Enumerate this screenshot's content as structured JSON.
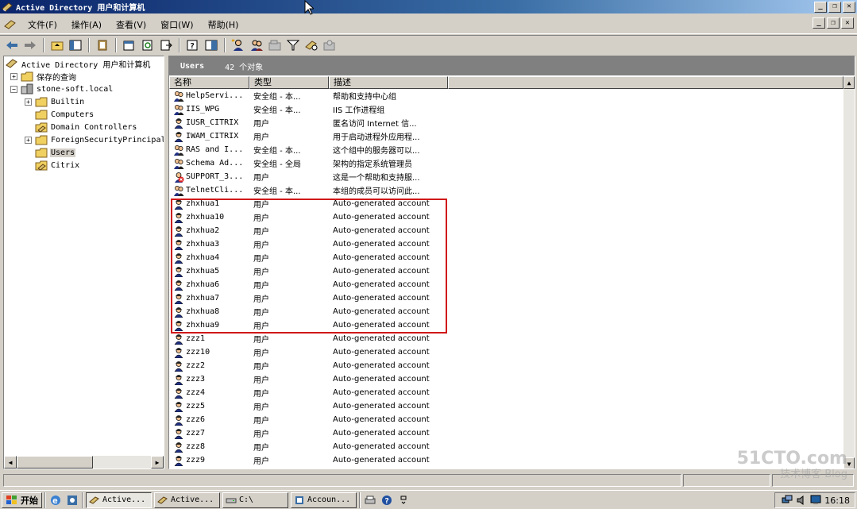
{
  "window": {
    "title": "Active Directory 用户和计算机"
  },
  "menu": {
    "items": [
      "文件(F)",
      "操作(A)",
      "查看(V)",
      "窗口(W)",
      "帮助(H)"
    ]
  },
  "tree": {
    "root": "Active Directory 用户和计算机",
    "saved_queries": "保存的查询",
    "domain": "stone-soft.local",
    "children": [
      "Builtin",
      "Computers",
      "Domain Controllers",
      "ForeignSecurityPrincipals",
      "Users",
      "Citrix"
    ],
    "selected": "Users"
  },
  "list": {
    "header_title": "Users",
    "object_count": "42 个对象",
    "columns": [
      "名称",
      "类型",
      "描述"
    ],
    "rows": [
      {
        "name": "HelpServi...",
        "type": "安全组 - 本...",
        "desc": "帮助和支持中心组",
        "icon": "group-icon"
      },
      {
        "name": "IIS_WPG",
        "type": "安全组 - 本...",
        "desc": "IIS 工作进程组",
        "icon": "group-icon"
      },
      {
        "name": "IUSR_CITRIX",
        "type": "用户",
        "desc": "匿名访问 Internet 信...",
        "icon": "user-icon"
      },
      {
        "name": "IWAM_CITRIX",
        "type": "用户",
        "desc": "用于启动进程外应用程...",
        "icon": "user-icon"
      },
      {
        "name": "RAS and I...",
        "type": "安全组 - 本...",
        "desc": "这个组中的服务器可以...",
        "icon": "group-icon"
      },
      {
        "name": "Schema Ad...",
        "type": "安全组 - 全局",
        "desc": "架构的指定系统管理员",
        "icon": "group-icon"
      },
      {
        "name": "SUPPORT_3...",
        "type": "用户",
        "desc": "这是一个帮助和支持服...",
        "icon": "disabled-user-icon"
      },
      {
        "name": "TelnetCli...",
        "type": "安全组 - 本...",
        "desc": "本组的成员可以访问此...",
        "icon": "group-icon"
      },
      {
        "name": "zhxhua1",
        "type": "用户",
        "desc": "Auto-generated account",
        "icon": "user-icon"
      },
      {
        "name": "zhxhua10",
        "type": "用户",
        "desc": "Auto-generated account",
        "icon": "user-icon"
      },
      {
        "name": "zhxhua2",
        "type": "用户",
        "desc": "Auto-generated account",
        "icon": "user-icon"
      },
      {
        "name": "zhxhua3",
        "type": "用户",
        "desc": "Auto-generated account",
        "icon": "user-icon"
      },
      {
        "name": "zhxhua4",
        "type": "用户",
        "desc": "Auto-generated account",
        "icon": "user-icon"
      },
      {
        "name": "zhxhua5",
        "type": "用户",
        "desc": "Auto-generated account",
        "icon": "user-icon"
      },
      {
        "name": "zhxhua6",
        "type": "用户",
        "desc": "Auto-generated account",
        "icon": "user-icon"
      },
      {
        "name": "zhxhua7",
        "type": "用户",
        "desc": "Auto-generated account",
        "icon": "user-icon"
      },
      {
        "name": "zhxhua8",
        "type": "用户",
        "desc": "Auto-generated account",
        "icon": "user-icon"
      },
      {
        "name": "zhxhua9",
        "type": "用户",
        "desc": "Auto-generated account",
        "icon": "user-icon"
      },
      {
        "name": "zzz1",
        "type": "用户",
        "desc": "Auto-generated account",
        "icon": "user-icon"
      },
      {
        "name": "zzz10",
        "type": "用户",
        "desc": "Auto-generated account",
        "icon": "user-icon"
      },
      {
        "name": "zzz2",
        "type": "用户",
        "desc": "Auto-generated account",
        "icon": "user-icon"
      },
      {
        "name": "zzz3",
        "type": "用户",
        "desc": "Auto-generated account",
        "icon": "user-icon"
      },
      {
        "name": "zzz4",
        "type": "用户",
        "desc": "Auto-generated account",
        "icon": "user-icon"
      },
      {
        "name": "zzz5",
        "type": "用户",
        "desc": "Auto-generated account",
        "icon": "user-icon"
      },
      {
        "name": "zzz6",
        "type": "用户",
        "desc": "Auto-generated account",
        "icon": "user-icon"
      },
      {
        "name": "zzz7",
        "type": "用户",
        "desc": "Auto-generated account",
        "icon": "user-icon"
      },
      {
        "name": "zzz8",
        "type": "用户",
        "desc": "Auto-generated account",
        "icon": "user-icon"
      },
      {
        "name": "zzz9",
        "type": "用户",
        "desc": "Auto-generated account",
        "icon": "user-icon"
      }
    ]
  },
  "taskbar": {
    "start_label": "开始",
    "tasks": [
      "Active...",
      "Active...",
      "C:\\",
      "Accoun..."
    ],
    "clock": "16:18"
  },
  "watermark": {
    "line1": "51CTO.com",
    "line2": "技术博客  Blog"
  },
  "colors": {
    "title_start": "#0a246a",
    "title_end": "#a6caf0",
    "highlight": "#d01818",
    "list_header": "#808080"
  }
}
